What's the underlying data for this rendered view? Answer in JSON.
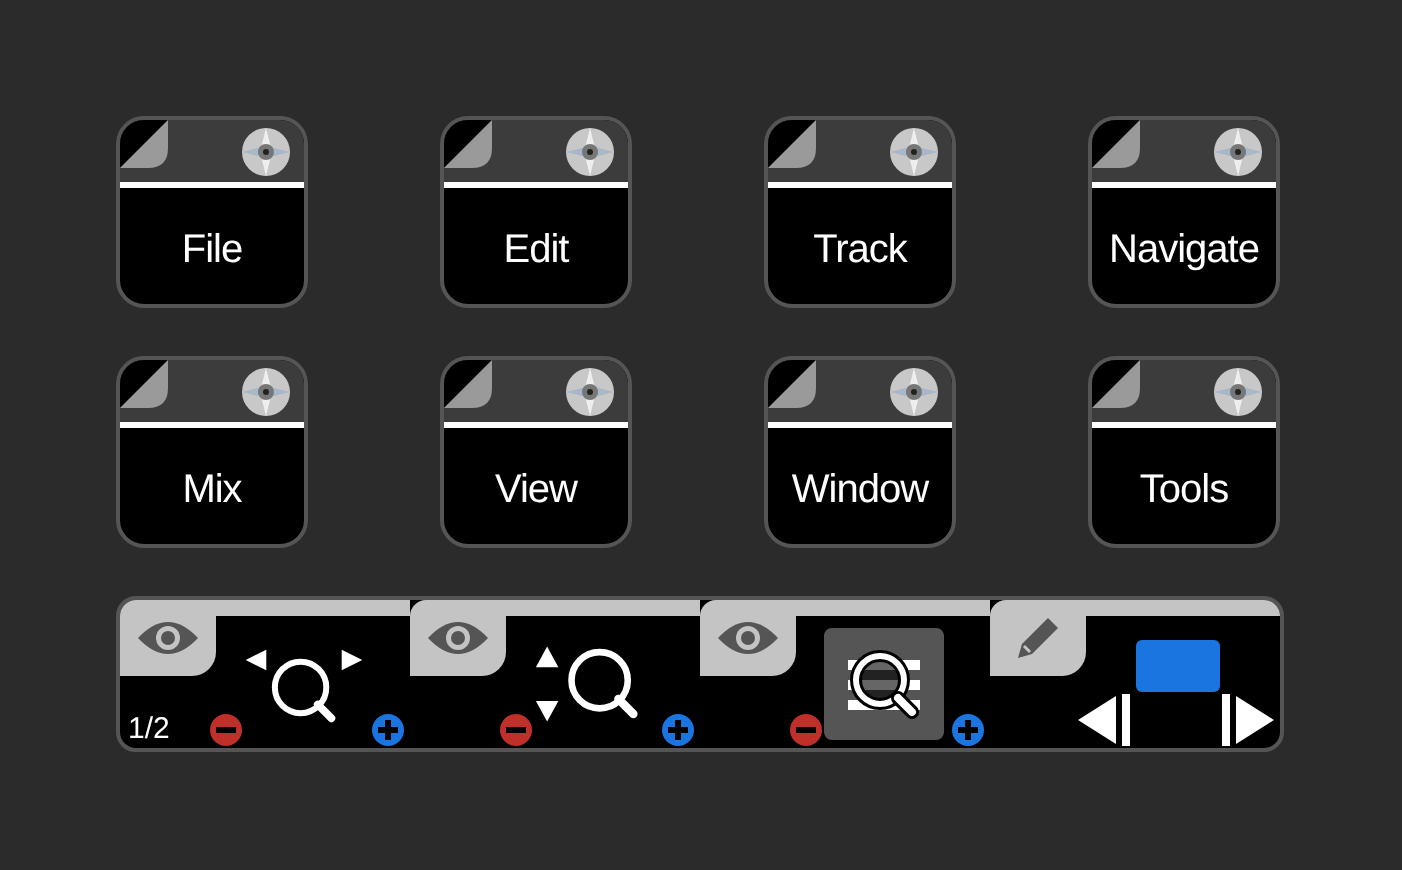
{
  "menu_buttons": [
    {
      "label": "File"
    },
    {
      "label": "Edit"
    },
    {
      "label": "Track"
    },
    {
      "label": "Navigate"
    },
    {
      "label": "Mix"
    },
    {
      "label": "View"
    },
    {
      "label": "Window"
    },
    {
      "label": "Tools"
    }
  ],
  "toolbar": {
    "page": "1/2",
    "sections": [
      {
        "kind": "zoom-horizontal",
        "selected": false
      },
      {
        "kind": "zoom-vertical",
        "selected": false
      },
      {
        "kind": "zoom-tracks",
        "selected": true
      },
      {
        "kind": "edit",
        "selected": false
      }
    ]
  }
}
